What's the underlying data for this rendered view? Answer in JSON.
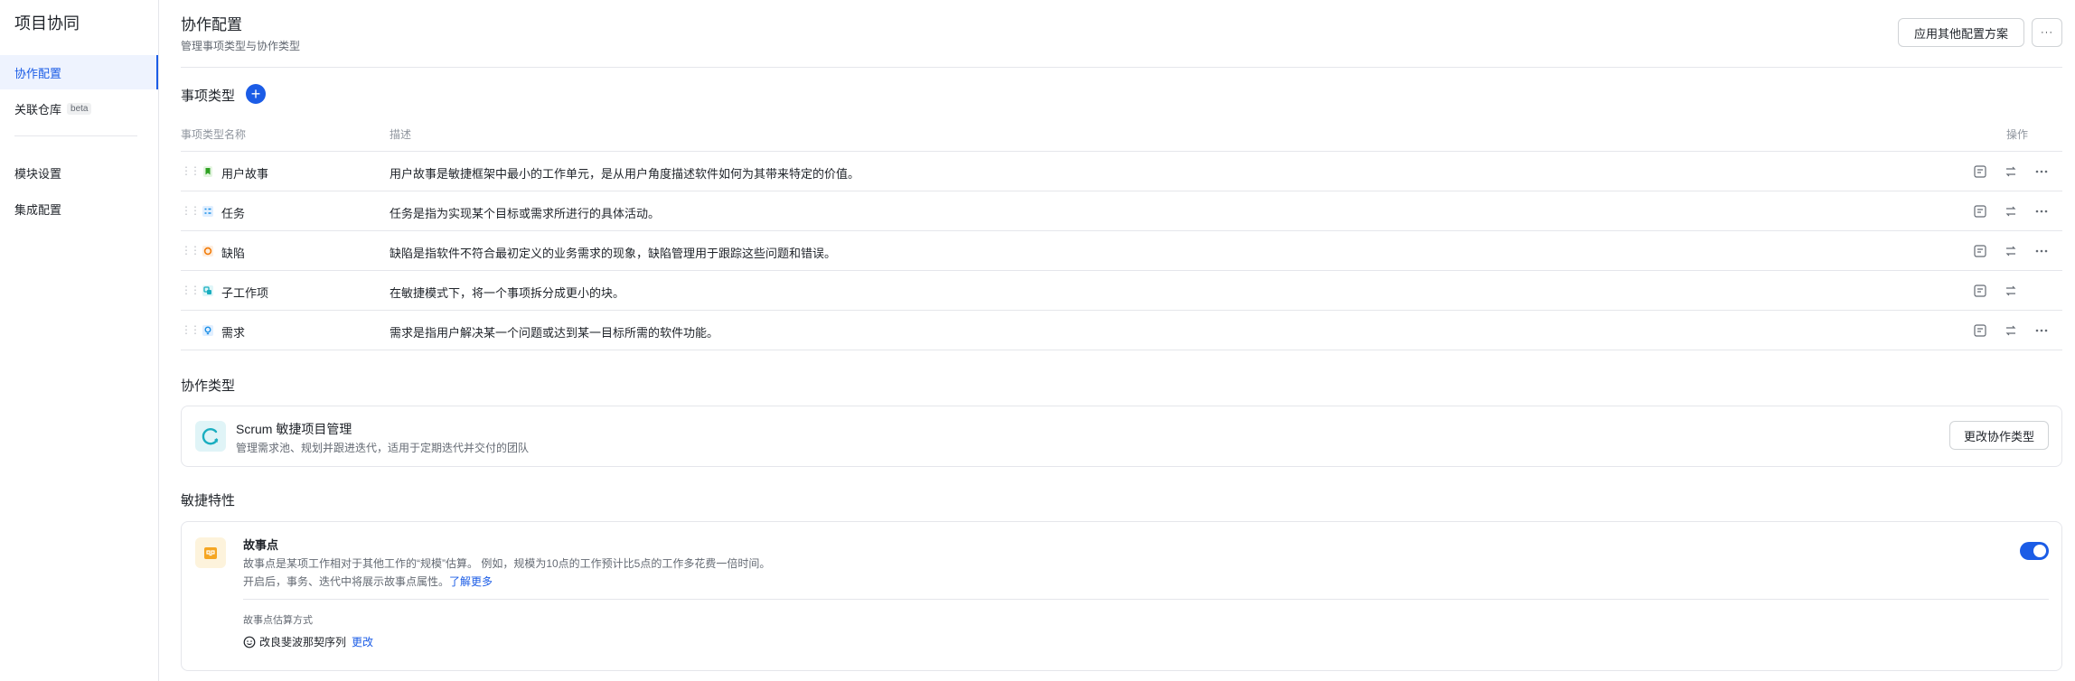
{
  "sidebar": {
    "title": "项目协同",
    "items": [
      {
        "label": "协作配置",
        "active": true
      },
      {
        "label": "关联仓库",
        "badge": "beta"
      },
      {
        "label": "模块设置"
      },
      {
        "label": "集成配置"
      }
    ]
  },
  "header": {
    "title": "协作配置",
    "subtitle": "管理事项类型与协作类型",
    "apply_button": "应用其他配置方案",
    "more_button": "···"
  },
  "item_types": {
    "section_title": "事项类型",
    "add_label": "+",
    "columns": {
      "name": "事项类型名称",
      "desc": "描述",
      "ops": "操作"
    },
    "rows": [
      {
        "name": "用户故事",
        "desc": "用户故事是敏捷框架中最小的工作单元，是从用户角度描述软件如何为其带来特定的价值。",
        "icon": "bookmark-icon",
        "color": "#2ea121",
        "has_more": true
      },
      {
        "name": "任务",
        "desc": "任务是指为实现某个目标或需求所进行的具体活动。",
        "icon": "checklist-icon",
        "color": "#1b8fe6",
        "has_more": true
      },
      {
        "name": "缺陷",
        "desc": "缺陷是指软件不符合最初定义的业务需求的现象，缺陷管理用于跟踪这些问题和错误。",
        "icon": "bug-circle-icon",
        "color": "#f27c0a",
        "has_more": true
      },
      {
        "name": "子工作项",
        "desc": "在敏捷模式下，将一个事项拆分成更小的块。",
        "icon": "sub-item-icon",
        "color": "#1aaec0",
        "has_more": false
      },
      {
        "name": "需求",
        "desc": "需求是指用户解决某一个问题或达到某一目标所需的软件功能。",
        "icon": "lightbulb-icon",
        "color": "#1b8fe6",
        "has_more": true
      }
    ]
  },
  "collab_type": {
    "section_title": "协作类型",
    "name": "Scrum 敏捷项目管理",
    "desc": "管理需求池、规划并跟进迭代，适用于定期迭代并交付的团队",
    "change_button": "更改协作类型"
  },
  "agile": {
    "section_title": "敏捷特性",
    "feature_title": "故事点",
    "line1": "故事点是某项工作相对于其他工作的“规模”估算。 例如，规模为10点的工作预计比5点的工作多花费一倍时间。",
    "line2": "开启后，事务、迭代中将展示故事点属性。",
    "learn_more": "了解更多",
    "enabled": true,
    "method_label": "故事点估算方式",
    "method_value": "改良斐波那契序列",
    "change_link": "更改"
  },
  "colors": {
    "accent": "#1b5ce6",
    "border": "#e5e6eb",
    "muted": "#646a73"
  }
}
